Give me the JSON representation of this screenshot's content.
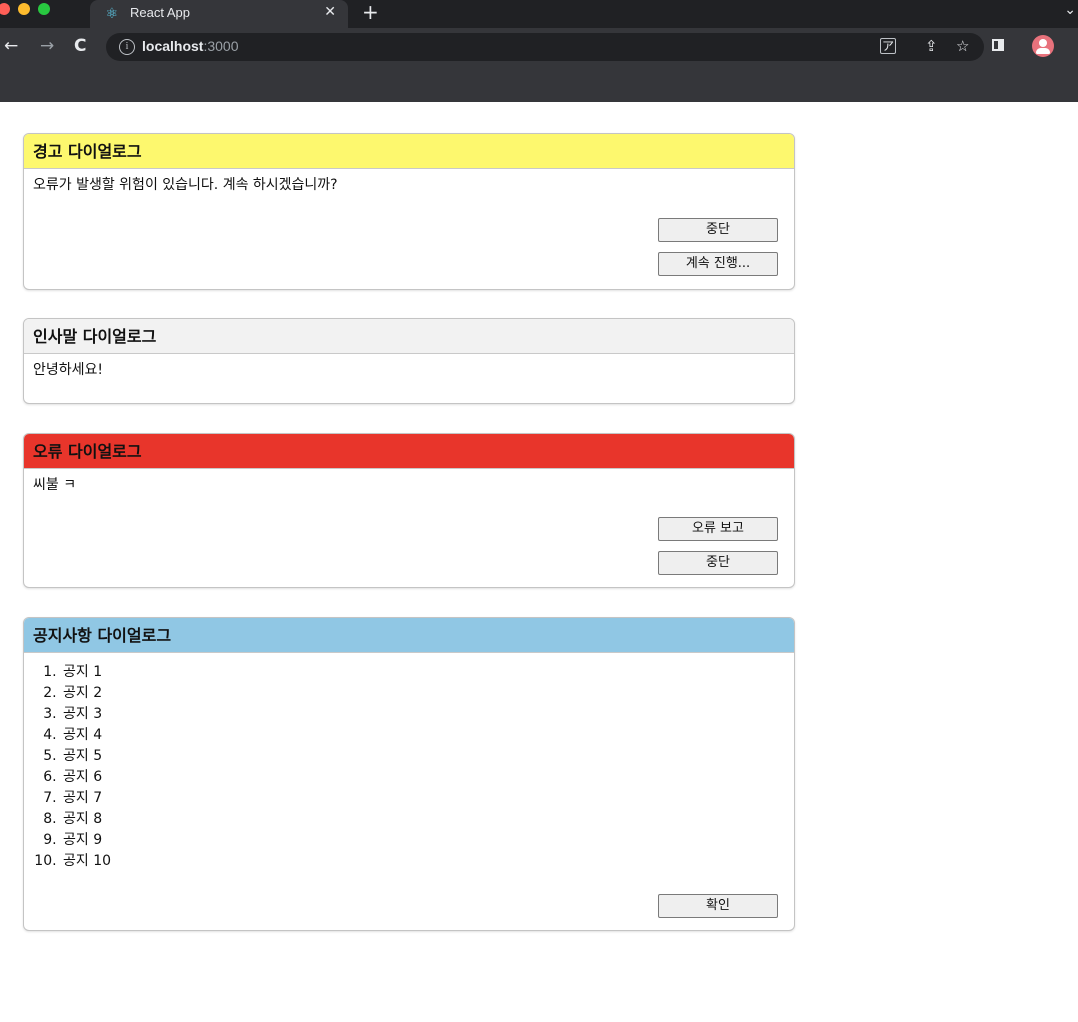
{
  "browser": {
    "tab_title": "React App",
    "url_host": "localhost",
    "url_port": ":3000"
  },
  "dialogs": [
    {
      "title": "경고 다이얼로그",
      "header_color": "#fdf86e",
      "message": "오류가 발생할 위험이 있습니다. 계속 하시겠습니까?",
      "buttons": [
        "중단",
        "계속 진행..."
      ]
    },
    {
      "title": "인사말 다이얼로그",
      "header_color": "#f2f2f2",
      "message": "안녕하세요!"
    },
    {
      "title": "오류 다이얼로그",
      "header_color": "#e8352b",
      "message": "씨불 ㅋ",
      "buttons": [
        "오류 보고",
        "중단"
      ]
    },
    {
      "title": "공지사항 다이얼로그",
      "header_color": "#90c7e4",
      "notices": [
        "공지 1",
        "공지 2",
        "공지 3",
        "공지 4",
        "공지 5",
        "공지 6",
        "공지 7",
        "공지 8",
        "공지 9",
        "공지 10"
      ],
      "buttons": [
        "확인"
      ]
    }
  ]
}
